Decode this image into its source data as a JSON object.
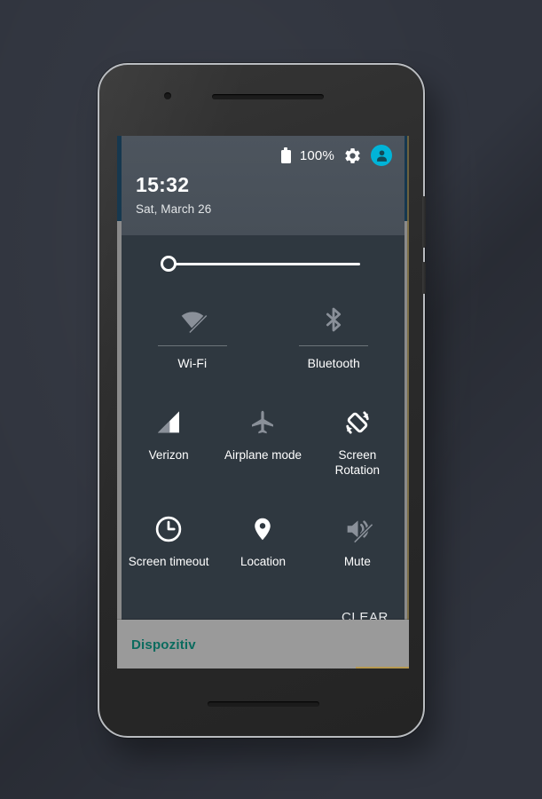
{
  "device": {
    "name": "android-phone-mockup",
    "front_camera": "camera-icon",
    "earpiece": "speaker-slot",
    "bottom_speaker": "speaker-slot"
  },
  "statusbar": {
    "battery_icon": "battery-full-icon",
    "battery_percent": "100%",
    "settings_icon": "gear-icon",
    "user_icon": "user-avatar-icon",
    "accent_color": "#00b4d8"
  },
  "header": {
    "time": "15:32",
    "date": "Sat, March 26",
    "background_color": "#4d555e"
  },
  "brightness": {
    "name": "brightness-slider",
    "value": 0,
    "min": 0,
    "max": 100,
    "track_color": "#ffffff"
  },
  "tiles_top": [
    {
      "label": "Wi-Fi",
      "icon": "wifi-off-icon",
      "enabled": false
    },
    {
      "label": "Bluetooth",
      "icon": "bluetooth-icon",
      "enabled": false
    }
  ],
  "tiles_mid": [
    {
      "label": "Verizon",
      "icon": "signal-cellular-icon",
      "enabled": true
    },
    {
      "label": "Airplane mode",
      "icon": "airplane-icon",
      "enabled": false
    },
    {
      "label": "Screen Rotation",
      "icon": "screen-rotation-icon",
      "enabled": true
    }
  ],
  "tiles_bot": [
    {
      "label": "Screen timeout",
      "icon": "clock-icon",
      "enabled": true
    },
    {
      "label": "Location",
      "icon": "location-pin-icon",
      "enabled": true
    },
    {
      "label": "Mute",
      "icon": "volume-mute-icon",
      "enabled": false
    }
  ],
  "footer": {
    "clear_label": "CLEAR"
  },
  "app_overlay": {
    "title": "Dispozitiv",
    "title_color": "#0a6b5e",
    "background_color": "#9a9a9a"
  },
  "colors": {
    "page_background": "#30343e",
    "panel_background": "#2f3840",
    "icon_active": "#ffffff",
    "icon_inactive": "#8a9099"
  }
}
